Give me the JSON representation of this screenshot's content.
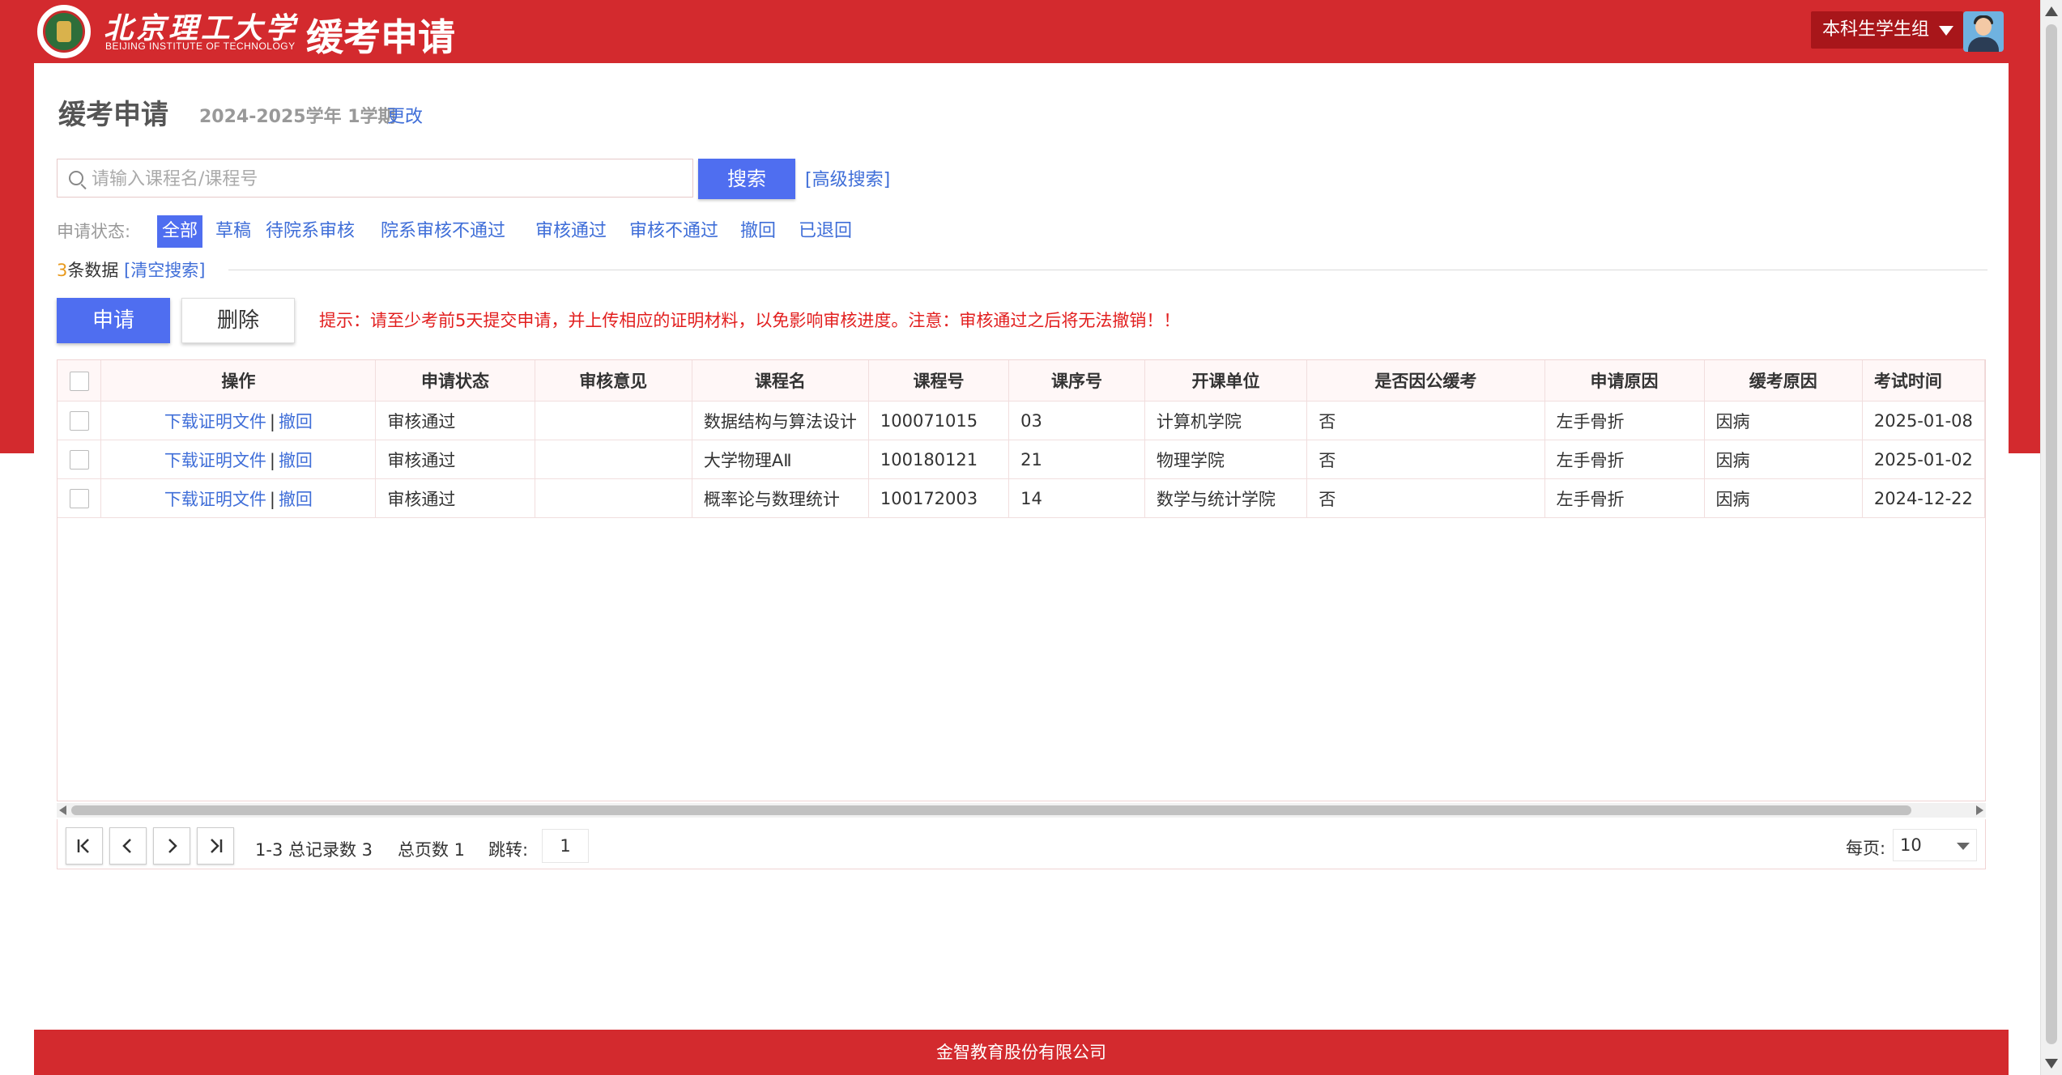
{
  "header": {
    "logo_cn": "北京理工大学",
    "logo_en": "BEIJING INSTITUTE OF TECHNOLOGY",
    "title": "缓考申请",
    "role": "本科生学生组"
  },
  "page": {
    "title": "缓考申请",
    "term": "2024-2025学年 1学期",
    "change_link": "更改"
  },
  "search": {
    "placeholder": "请输入课程名/课程号",
    "button": "搜索",
    "advanced": "[高级搜索]"
  },
  "status_filter": {
    "label": "申请状态:",
    "tabs": [
      "全部",
      "草稿",
      "待院系审核",
      "院系审核不通过",
      "审核通过",
      "审核不通过",
      "撤回",
      "已退回"
    ],
    "active": "全部"
  },
  "results": {
    "count": "3",
    "count_suffix": "条数据",
    "clear": "[清空搜索]"
  },
  "actions": {
    "apply": "申请",
    "delete": "删除",
    "tip": "提示：请至少考前5天提交申请，并上传相应的证明材料，以免影响审核进度。注意：审核通过之后将无法撤销！！"
  },
  "table": {
    "columns": [
      "操作",
      "申请状态",
      "审核意见",
      "课程名",
      "课程号",
      "课序号",
      "开课单位",
      "是否因公缓考",
      "申请原因",
      "缓考原因",
      "考试时间"
    ],
    "op_links": {
      "download": "下载证明文件",
      "sep": "|",
      "withdraw": "撤回"
    },
    "rows": [
      {
        "status": "审核通过",
        "opinion": "",
        "course": "数据结构与算法设计",
        "course_no": "100071015",
        "seq": "03",
        "dept": "计算机学院",
        "official": "否",
        "reason": "左手骨折",
        "defer_reason": "因病",
        "exam_time": "2025-01-08"
      },
      {
        "status": "审核通过",
        "opinion": "",
        "course": "大学物理AⅡ",
        "course_no": "100180121",
        "seq": "21",
        "dept": "物理学院",
        "official": "否",
        "reason": "左手骨折",
        "defer_reason": "因病",
        "exam_time": "2025-01-02"
      },
      {
        "status": "审核通过",
        "opinion": "",
        "course": "概率论与数理统计",
        "course_no": "100172003",
        "seq": "14",
        "dept": "数学与统计学院",
        "official": "否",
        "reason": "左手骨折",
        "defer_reason": "因病",
        "exam_time": "2024-12-22"
      }
    ]
  },
  "pager": {
    "range": "1-3 总记录数 3",
    "total_pages": "总页数 1",
    "jump_label": "跳转:",
    "jump_value": "1",
    "per_page_label": "每页:",
    "per_page_value": "10"
  },
  "footer": {
    "company": "金智教育股份有限公司"
  },
  "colors": {
    "brand_red": "#d32a2e",
    "primary_blue": "#4f6ef0",
    "link_blue": "#3f6ed8",
    "tip_red": "#e21f1f"
  }
}
